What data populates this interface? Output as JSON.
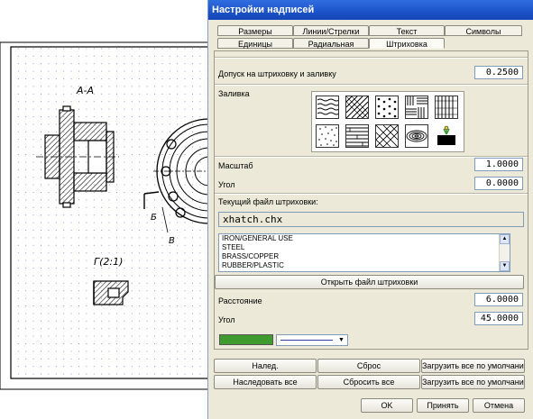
{
  "cad": {
    "section_label": "А-А",
    "view_label": "Г(2:1)",
    "letter_b": "Б",
    "letter_v": "В"
  },
  "dialog": {
    "title": "Настройки надписей",
    "tabs_row1": [
      "Размеры",
      "Линии/Стрелки",
      "Текст",
      "Символы"
    ],
    "tabs_row2": [
      "Единицы",
      "Радиальная",
      "Штриховка"
    ],
    "active_tab": "Штриховка",
    "tolerance_label": "Допуск на штриховку и заливку",
    "tolerance_value": "0.2500",
    "fill_label": "Заливка",
    "scale_label": "Масштаб",
    "scale_value": "1.0000",
    "angle_label": "Угол",
    "angle_value": "0.0000",
    "file_label": "Текущий файл штриховки:",
    "file_value": "xhatch.chx",
    "materials": [
      "IRON/GENERAL USE",
      "STEEL",
      "BRASS/COPPER",
      "RUBBER/PLASTIC"
    ],
    "open_file_button": "Открыть файл штриховки",
    "distance_label": "Расстояние",
    "distance_value": "6.0000",
    "angle2_label": "Угол",
    "angle2_value": "45.0000",
    "color_hex": "#3f9b30",
    "buttons_row1": [
      "Налед.",
      "Сброс",
      "Загрузить все по умолчанию"
    ],
    "buttons_row2": [
      "Наследовать все",
      "Сбросить все",
      "Загрузить все по умолчанию"
    ],
    "ok": "OK",
    "apply": "Принять",
    "cancel": "Отмена"
  }
}
